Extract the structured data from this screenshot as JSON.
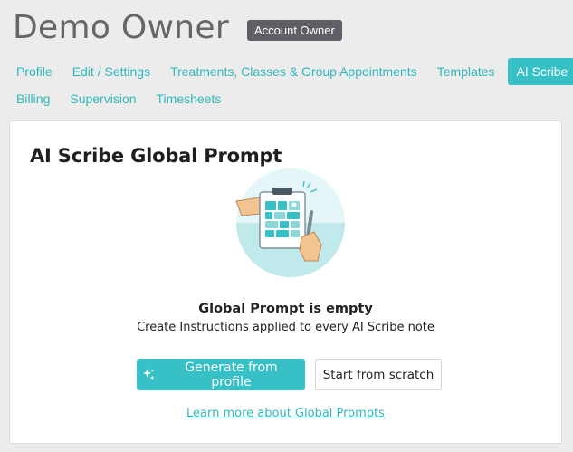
{
  "header": {
    "owner_name": "Demo Owner",
    "role_badge": "Account Owner"
  },
  "tabs": {
    "row1": [
      {
        "label": "Profile",
        "active": false
      },
      {
        "label": "Edit / Settings",
        "active": false
      },
      {
        "label": "Treatments, Classes & Group Appointments",
        "active": false
      },
      {
        "label": "Templates",
        "active": false
      },
      {
        "label": "AI Scribe",
        "active": true
      }
    ],
    "row2": [
      {
        "label": "Billing",
        "active": false
      },
      {
        "label": "Supervision",
        "active": false
      },
      {
        "label": "Timesheets",
        "active": false
      }
    ]
  },
  "card": {
    "title": "AI Scribe Global Prompt",
    "illustration_icon": "clipboard-with-pen-illustration",
    "empty_title": "Global Prompt is empty",
    "empty_subtitle": "Create Instructions applied to every AI Scribe note",
    "generate_button": "Generate from profile",
    "generate_icon": "sparkle-icon",
    "scratch_button": "Start from scratch",
    "learn_link": "Learn more about Global Prompts"
  },
  "colors": {
    "accent": "#37c0c5",
    "link": "#2fb8bd",
    "badge_bg": "#5f5f66",
    "page_bg": "#ececec"
  }
}
